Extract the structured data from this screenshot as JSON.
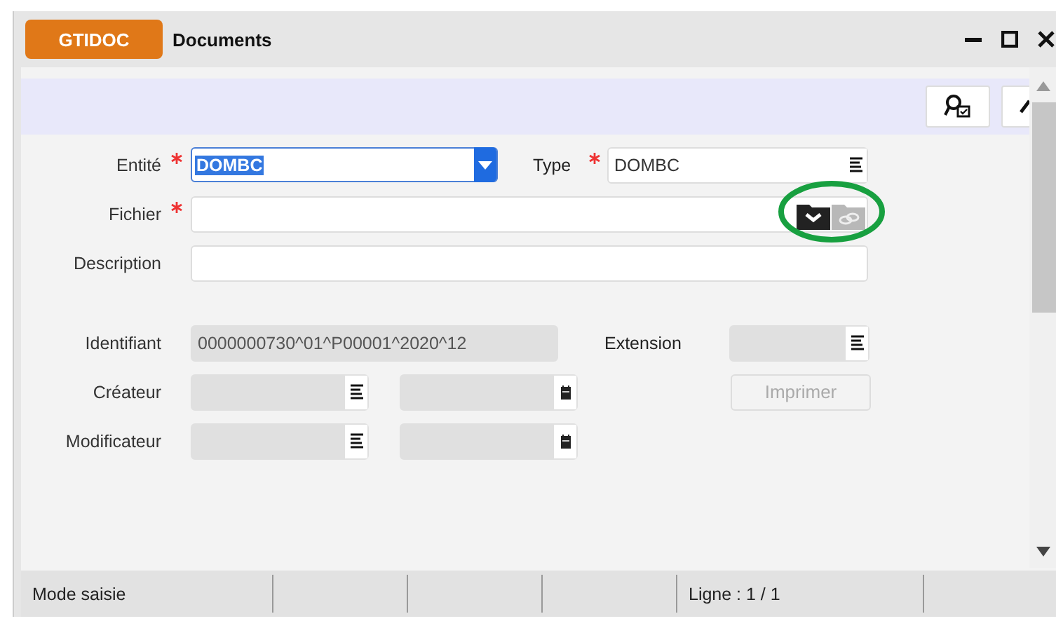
{
  "window": {
    "app_badge": "GTIDOC",
    "title": "Documents"
  },
  "form": {
    "entite": {
      "label": "Entité",
      "required": true,
      "value": "DOMBC",
      "text_selected": true
    },
    "type": {
      "label": "Type",
      "required": true,
      "value": "DOMBC"
    },
    "fichier": {
      "label": "Fichier",
      "required": true
    },
    "description": {
      "label": "Description",
      "required": false
    },
    "identifiant": {
      "label": "Identifiant",
      "value": "0000000730^01^P00001^2020^12",
      "disabled": true
    },
    "extension": {
      "label": "Extension",
      "disabled": true
    },
    "createur": {
      "label": "Créateur",
      "disabled": true
    },
    "modificateur": {
      "label": "Modificateur",
      "disabled": true
    },
    "print_button": {
      "label": "Imprimer",
      "disabled": true
    }
  },
  "status_bar": {
    "mode": "Mode saisie",
    "position": "Ligne : 1 / 1"
  }
}
